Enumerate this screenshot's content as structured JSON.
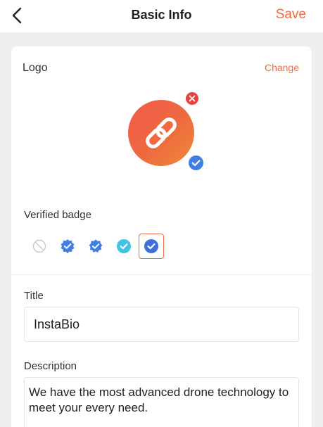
{
  "nav": {
    "title": "Basic Info",
    "save_label": "Save",
    "back_icon": "chevron-left-icon"
  },
  "logo_section": {
    "label": "Logo",
    "change_label": "Change",
    "logo_icon": "link-icon",
    "remove_icon": "close-icon",
    "verified_icon": "verified-check-icon"
  },
  "badge_section": {
    "label": "Verified badge",
    "options": [
      {
        "icon": "none-icon",
        "selected": false
      },
      {
        "icon": "badge-scalloped-blue-icon",
        "selected": false
      },
      {
        "icon": "badge-scalloped-blue-icon",
        "selected": false
      },
      {
        "icon": "badge-circle-cyan-icon",
        "selected": false
      },
      {
        "icon": "badge-circle-blue-icon",
        "selected": true
      }
    ]
  },
  "title_field": {
    "label": "Title",
    "value": "InstaBio"
  },
  "description_field": {
    "label": "Description",
    "value": "We have the most advanced drone technology to meet your every need."
  },
  "colors": {
    "accent": "#ef6b44",
    "badge_blue": "#3f7fe4",
    "badge_cyan": "#3ec2e8",
    "remove_red": "#e64040"
  }
}
